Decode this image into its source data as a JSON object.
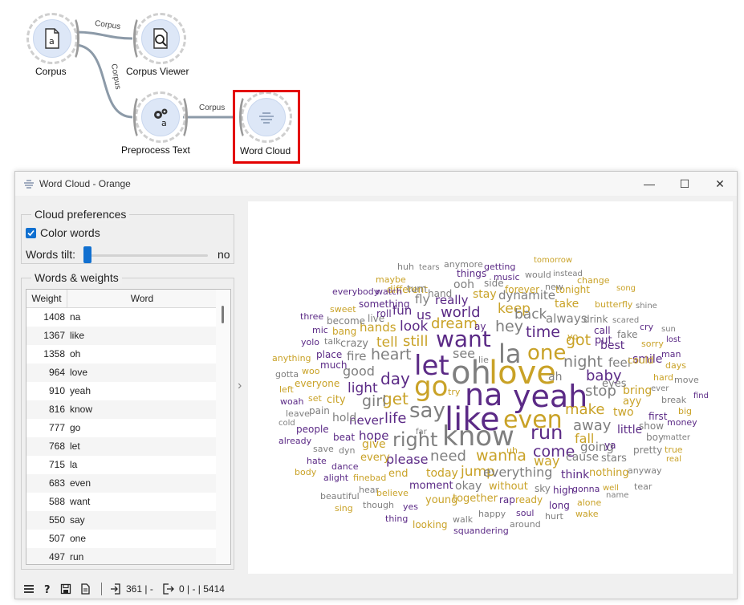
{
  "workflow": {
    "nodes": {
      "corpus": "Corpus",
      "corpus_viewer": "Corpus Viewer",
      "preprocess": "Preprocess Text",
      "word_cloud": "Word Cloud"
    },
    "links": [
      "Corpus",
      "Corpus",
      "Corpus"
    ]
  },
  "window": {
    "title": "Word Cloud - Orange",
    "buttons": {
      "minimize": "—",
      "maximize": "☐",
      "close": "✕"
    }
  },
  "cloud_prefs": {
    "title": "Cloud preferences",
    "color_words_label": "Color words",
    "color_words_checked": true,
    "words_tilt_label": "Words tilt:",
    "words_tilt_value": "no"
  },
  "words_weights": {
    "title": "Words & weights",
    "columns": [
      "Weight",
      "Word"
    ],
    "rows": [
      [
        "1408",
        "na"
      ],
      [
        "1367",
        "like"
      ],
      [
        "1358",
        "oh"
      ],
      [
        "964",
        "love"
      ],
      [
        "910",
        "yeah"
      ],
      [
        "816",
        "know"
      ],
      [
        "777",
        "go"
      ],
      [
        "768",
        "let"
      ],
      [
        "715",
        "la"
      ],
      [
        "683",
        "even"
      ],
      [
        "588",
        "want"
      ],
      [
        "550",
        "say"
      ],
      [
        "507",
        "one"
      ],
      [
        "497",
        "run"
      ]
    ]
  },
  "colors": {
    "gold": "#c9a227",
    "purple": "#5b2a86",
    "gray": "#7f7f7f",
    "accent": "#1170d0",
    "highlight": "#e30000"
  },
  "cloud_words": [
    {
      "t": "na",
      "s": 38,
      "c": "purple"
    },
    {
      "t": "like",
      "s": 40,
      "c": "purple"
    },
    {
      "t": "oh",
      "s": 40,
      "c": "gray"
    },
    {
      "t": "love",
      "s": 40,
      "c": "gold"
    },
    {
      "t": "yeah",
      "s": 38,
      "c": "purple"
    },
    {
      "t": "know",
      "s": 34,
      "c": "gray"
    },
    {
      "t": "go",
      "s": 34,
      "c": "gold"
    },
    {
      "t": "let",
      "s": 34,
      "c": "purple"
    },
    {
      "t": "la",
      "s": 32,
      "c": "gray"
    },
    {
      "t": "even",
      "s": 30,
      "c": "gold"
    },
    {
      "t": "want",
      "s": 28,
      "c": "purple"
    },
    {
      "t": "say",
      "s": 26,
      "c": "gray"
    },
    {
      "t": "one",
      "s": 26,
      "c": "gold"
    },
    {
      "t": "run",
      "s": 24,
      "c": "purple"
    },
    {
      "t": "right",
      "s": 24,
      "c": "gray"
    },
    {
      "t": "come",
      "s": 19,
      "c": "purple"
    },
    {
      "t": "day",
      "s": 20,
      "c": "purple"
    },
    {
      "t": "heart",
      "s": 19,
      "c": "gray"
    },
    {
      "t": "get",
      "s": 20,
      "c": "gold"
    },
    {
      "t": "girl",
      "s": 19,
      "c": "gray"
    },
    {
      "t": "life",
      "s": 18,
      "c": "purple"
    },
    {
      "t": "still",
      "s": 18,
      "c": "gold"
    },
    {
      "t": "tell",
      "s": 17,
      "c": "gold"
    },
    {
      "t": "look",
      "s": 17,
      "c": "purple"
    },
    {
      "t": "hey",
      "s": 19,
      "c": "gray"
    },
    {
      "t": "dream",
      "s": 18,
      "c": "gold"
    },
    {
      "t": "world",
      "s": 18,
      "c": "purple"
    },
    {
      "t": "keep",
      "s": 17,
      "c": "gold"
    },
    {
      "t": "back",
      "s": 17,
      "c": "gray"
    },
    {
      "t": "time",
      "s": 19,
      "c": "purple"
    },
    {
      "t": "got",
      "s": 19,
      "c": "gold"
    },
    {
      "t": "night",
      "s": 19,
      "c": "gray"
    },
    {
      "t": "baby",
      "s": 18,
      "c": "purple"
    },
    {
      "t": "stop",
      "s": 18,
      "c": "gray"
    },
    {
      "t": "make",
      "s": 18,
      "c": "gold"
    },
    {
      "t": "away",
      "s": 18,
      "c": "gray"
    },
    {
      "t": "fall",
      "s": 16,
      "c": "gold"
    },
    {
      "t": "wanna",
      "s": 19,
      "c": "gold"
    },
    {
      "t": "need",
      "s": 18,
      "c": "gray"
    },
    {
      "t": "jump",
      "s": 17,
      "c": "gold"
    },
    {
      "t": "everything",
      "s": 16,
      "c": "gray"
    },
    {
      "t": "way",
      "s": 16,
      "c": "gold"
    },
    {
      "t": "please",
      "s": 16,
      "c": "purple"
    },
    {
      "t": "never",
      "s": 15,
      "c": "purple"
    },
    {
      "t": "hope",
      "s": 15,
      "c": "purple"
    },
    {
      "t": "light",
      "s": 17,
      "c": "purple"
    },
    {
      "t": "good",
      "s": 16,
      "c": "gray"
    },
    {
      "t": "fire",
      "s": 15,
      "c": "gray"
    },
    {
      "t": "see",
      "s": 16,
      "c": "gray"
    },
    {
      "t": "us",
      "s": 16,
      "c": "purple"
    },
    {
      "t": "fun",
      "s": 15,
      "c": "purple"
    },
    {
      "t": "really",
      "s": 15,
      "c": "purple"
    },
    {
      "t": "fly",
      "s": 15,
      "c": "gray"
    },
    {
      "t": "hands",
      "s": 15,
      "c": "gold"
    },
    {
      "t": "dynamite",
      "s": 15,
      "c": "gray"
    },
    {
      "t": "stay",
      "s": 14,
      "c": "gold"
    },
    {
      "t": "ooh",
      "s": 14,
      "c": "gray"
    },
    {
      "t": "always",
      "s": 15,
      "c": "gray"
    },
    {
      "t": "take",
      "s": 14,
      "c": "gold"
    },
    {
      "t": "bring",
      "s": 14,
      "c": "gold"
    },
    {
      "t": "feel",
      "s": 15,
      "c": "gray"
    },
    {
      "t": "best",
      "s": 14,
      "c": "purple"
    },
    {
      "t": "little",
      "s": 14,
      "c": "purple"
    },
    {
      "t": "smile",
      "s": 14,
      "c": "purple"
    },
    {
      "t": "going",
      "s": 15,
      "c": "gray"
    },
    {
      "t": "cause",
      "s": 14,
      "c": "gray"
    },
    {
      "t": "two",
      "s": 14,
      "c": "gold"
    },
    {
      "t": "today",
      "s": 14,
      "c": "gold"
    },
    {
      "t": "okay",
      "s": 14,
      "c": "gray"
    },
    {
      "t": "moment",
      "s": 13,
      "c": "purple"
    },
    {
      "t": "without",
      "s": 13,
      "c": "gold"
    },
    {
      "t": "think",
      "s": 14,
      "c": "purple"
    },
    {
      "t": "stars",
      "s": 13,
      "c": "gray"
    },
    {
      "t": "nothing",
      "s": 13,
      "c": "gold"
    },
    {
      "t": "together",
      "s": 13,
      "c": "gold"
    },
    {
      "t": "young",
      "s": 13,
      "c": "gold"
    },
    {
      "t": "ready",
      "s": 12,
      "c": "gold"
    },
    {
      "t": "rap",
      "s": 12,
      "c": "purple"
    },
    {
      "t": "end",
      "s": 13,
      "c": "gold"
    },
    {
      "t": "every",
      "s": 13,
      "c": "gold"
    },
    {
      "t": "give",
      "s": 14,
      "c": "gold"
    },
    {
      "t": "people",
      "s": 12,
      "c": "purple"
    },
    {
      "t": "hold",
      "s": 14,
      "c": "gray"
    },
    {
      "t": "city",
      "s": 13,
      "c": "gold"
    },
    {
      "t": "everyone",
      "s": 12,
      "c": "gold"
    },
    {
      "t": "crazy",
      "s": 13,
      "c": "gray"
    },
    {
      "t": "something",
      "s": 12,
      "c": "purple"
    },
    {
      "t": "different",
      "s": 12,
      "c": "gold"
    },
    {
      "t": "things",
      "s": 12,
      "c": "purple"
    },
    {
      "t": "getting",
      "s": 11,
      "c": "purple"
    },
    {
      "t": "forever",
      "s": 12,
      "c": "gold"
    },
    {
      "t": "tonight",
      "s": 12,
      "c": "gold"
    },
    {
      "t": "change",
      "s": 11,
      "c": "gold"
    },
    {
      "t": "butterfly",
      "s": 11,
      "c": "gold"
    },
    {
      "t": "drink",
      "s": 12,
      "c": "gray"
    },
    {
      "t": "call",
      "s": 12,
      "c": "purple"
    },
    {
      "t": "put",
      "s": 13,
      "c": "purple"
    },
    {
      "t": "fake",
      "s": 12,
      "c": "gray"
    },
    {
      "t": "could",
      "s": 12,
      "c": "gold"
    },
    {
      "t": "eyes",
      "s": 13,
      "c": "gray"
    },
    {
      "t": "ayy",
      "s": 13,
      "c": "gold"
    },
    {
      "t": "first",
      "s": 12,
      "c": "purple"
    },
    {
      "t": "show",
      "s": 12,
      "c": "gray"
    },
    {
      "t": "boy",
      "s": 12,
      "c": "gray"
    },
    {
      "t": "pretty",
      "s": 12,
      "c": "gray"
    },
    {
      "t": "anyway",
      "s": 11,
      "c": "gray"
    },
    {
      "t": "tear",
      "s": 11,
      "c": "gray"
    },
    {
      "t": "gonna",
      "s": 11,
      "c": "purple"
    },
    {
      "t": "high",
      "s": 12,
      "c": "purple"
    },
    {
      "t": "sky",
      "s": 12,
      "c": "gray"
    },
    {
      "t": "long",
      "s": 12,
      "c": "purple"
    },
    {
      "t": "alone",
      "s": 11,
      "c": "gold"
    },
    {
      "t": "wake",
      "s": 11,
      "c": "gold"
    },
    {
      "t": "hurt",
      "s": 11,
      "c": "gray"
    },
    {
      "t": "soul",
      "s": 11,
      "c": "purple"
    },
    {
      "t": "around",
      "s": 11,
      "c": "gray"
    },
    {
      "t": "happy",
      "s": 11,
      "c": "gray"
    },
    {
      "t": "walk",
      "s": 11,
      "c": "gray"
    },
    {
      "t": "squandering",
      "s": 11,
      "c": "purple"
    },
    {
      "t": "looking",
      "s": 12,
      "c": "gold"
    },
    {
      "t": "thing",
      "s": 11,
      "c": "purple"
    },
    {
      "t": "yes",
      "s": 11,
      "c": "purple"
    },
    {
      "t": "though",
      "s": 11,
      "c": "gray"
    },
    {
      "t": "believe",
      "s": 11,
      "c": "gold"
    },
    {
      "t": "hear",
      "s": 11,
      "c": "gray"
    },
    {
      "t": "beautiful",
      "s": 11,
      "c": "gray"
    },
    {
      "t": "sing",
      "s": 11,
      "c": "gold"
    },
    {
      "t": "alight",
      "s": 11,
      "c": "purple"
    },
    {
      "t": "finebad",
      "s": 11,
      "c": "gold"
    },
    {
      "t": "dance",
      "s": 11,
      "c": "purple"
    },
    {
      "t": "dyn",
      "s": 11,
      "c": "gray"
    },
    {
      "t": "save",
      "s": 11,
      "c": "gray"
    },
    {
      "t": "hate",
      "s": 11,
      "c": "purple"
    },
    {
      "t": "body",
      "s": 11,
      "c": "gold"
    },
    {
      "t": "beat",
      "s": 12,
      "c": "purple"
    },
    {
      "t": "already",
      "s": 11,
      "c": "purple"
    },
    {
      "t": "cold",
      "s": 10,
      "c": "gray"
    },
    {
      "t": "leave",
      "s": 11,
      "c": "gray"
    },
    {
      "t": "pain",
      "s": 12,
      "c": "gray"
    },
    {
      "t": "set",
      "s": 11,
      "c": "gold"
    },
    {
      "t": "woah",
      "s": 11,
      "c": "purple"
    },
    {
      "t": "left",
      "s": 11,
      "c": "gold"
    },
    {
      "t": "gotta",
      "s": 11,
      "c": "gray"
    },
    {
      "t": "woo",
      "s": 11,
      "c": "gold"
    },
    {
      "t": "anything",
      "s": 11,
      "c": "gold"
    },
    {
      "t": "much",
      "s": 12,
      "c": "purple"
    },
    {
      "t": "place",
      "s": 12,
      "c": "purple"
    },
    {
      "t": "talk",
      "s": 11,
      "c": "gray"
    },
    {
      "t": "yolo",
      "s": 11,
      "c": "purple"
    },
    {
      "t": "mic",
      "s": 11,
      "c": "purple"
    },
    {
      "t": "bang",
      "s": 12,
      "c": "gold"
    },
    {
      "t": "three",
      "s": 11,
      "c": "purple"
    },
    {
      "t": "sweet",
      "s": 11,
      "c": "gold"
    },
    {
      "t": "become",
      "s": 12,
      "c": "gray"
    },
    {
      "t": "live",
      "s": 12,
      "c": "gray"
    },
    {
      "t": "roll",
      "s": 12,
      "c": "purple"
    },
    {
      "t": "everybody",
      "s": 11,
      "c": "purple"
    },
    {
      "t": "watch",
      "s": 11,
      "c": "purple"
    },
    {
      "t": "turn",
      "s": 12,
      "c": "gray"
    },
    {
      "t": "hand",
      "s": 12,
      "c": "gray"
    },
    {
      "t": "side",
      "s": 12,
      "c": "gray"
    },
    {
      "t": "maybe",
      "s": 11,
      "c": "gold"
    },
    {
      "t": "huh",
      "s": 11,
      "c": "gray"
    },
    {
      "t": "tears",
      "s": 10,
      "c": "gray"
    },
    {
      "t": "anymore",
      "s": 11,
      "c": "gray"
    },
    {
      "t": "music",
      "s": 11,
      "c": "purple"
    },
    {
      "t": "would",
      "s": 11,
      "c": "gray"
    },
    {
      "t": "tomorrow",
      "s": 10,
      "c": "gold"
    },
    {
      "t": "new",
      "s": 11,
      "c": "gray"
    },
    {
      "t": "instead",
      "s": 10,
      "c": "gray"
    },
    {
      "t": "song",
      "s": 10,
      "c": "gold"
    },
    {
      "t": "shine",
      "s": 10,
      "c": "gray"
    },
    {
      "t": "scared",
      "s": 10,
      "c": "gray"
    },
    {
      "t": "cry",
      "s": 11,
      "c": "purple"
    },
    {
      "t": "sun",
      "s": 10,
      "c": "gray"
    },
    {
      "t": "lost",
      "s": 10,
      "c": "purple"
    },
    {
      "t": "sorry",
      "s": 11,
      "c": "gold"
    },
    {
      "t": "man",
      "s": 11,
      "c": "purple"
    },
    {
      "t": "days",
      "s": 11,
      "c": "gold"
    },
    {
      "t": "hard",
      "s": 11,
      "c": "gold"
    },
    {
      "t": "move",
      "s": 11,
      "c": "gray"
    },
    {
      "t": "ever",
      "s": 10,
      "c": "gray"
    },
    {
      "t": "find",
      "s": 10,
      "c": "purple"
    },
    {
      "t": "break",
      "s": 11,
      "c": "gray"
    },
    {
      "t": "big",
      "s": 11,
      "c": "gold"
    },
    {
      "t": "money",
      "s": 11,
      "c": "purple"
    },
    {
      "t": "matter",
      "s": 10,
      "c": "gray"
    },
    {
      "t": "true",
      "s": 11,
      "c": "gold"
    },
    {
      "t": "real",
      "s": 10,
      "c": "gold"
    },
    {
      "t": "well",
      "s": 10,
      "c": "gold"
    },
    {
      "t": "name",
      "s": 10,
      "c": "gray"
    },
    {
      "t": "ah",
      "s": 14,
      "c": "gray"
    },
    {
      "t": "uh",
      "s": 11,
      "c": "gold"
    },
    {
      "t": "ya",
      "s": 12,
      "c": "purple"
    },
    {
      "t": "yo",
      "s": 11,
      "c": "gold"
    },
    {
      "t": "ay",
      "s": 12,
      "c": "purple"
    },
    {
      "t": "lie",
      "s": 11,
      "c": "gray"
    },
    {
      "t": "try",
      "s": 11,
      "c": "gold"
    },
    {
      "t": "far",
      "s": 10,
      "c": "gray"
    }
  ],
  "statusbar": {
    "input_count": "361",
    "dash1": "|",
    "output_text": "0 | - | 5414"
  }
}
